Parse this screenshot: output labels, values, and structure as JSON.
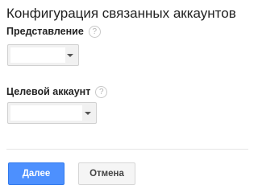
{
  "dialog": {
    "title": "Конфигурация связанных аккаунтов"
  },
  "fields": {
    "view": {
      "label": "Представление",
      "help_icon": "question-mark-circle-icon",
      "help_glyph": "?",
      "value": ""
    },
    "target_account": {
      "label": "Целевой аккаунт",
      "help_icon": "question-mark-circle-icon",
      "help_glyph": "?",
      "value": ""
    }
  },
  "actions": {
    "done_label": "Далее",
    "cancel_label": "Отмена"
  },
  "colors": {
    "primary": "#4d90fe",
    "primary_border": "#3079ed",
    "secondary_bg": "#f5f5f5",
    "text": "#212121"
  }
}
